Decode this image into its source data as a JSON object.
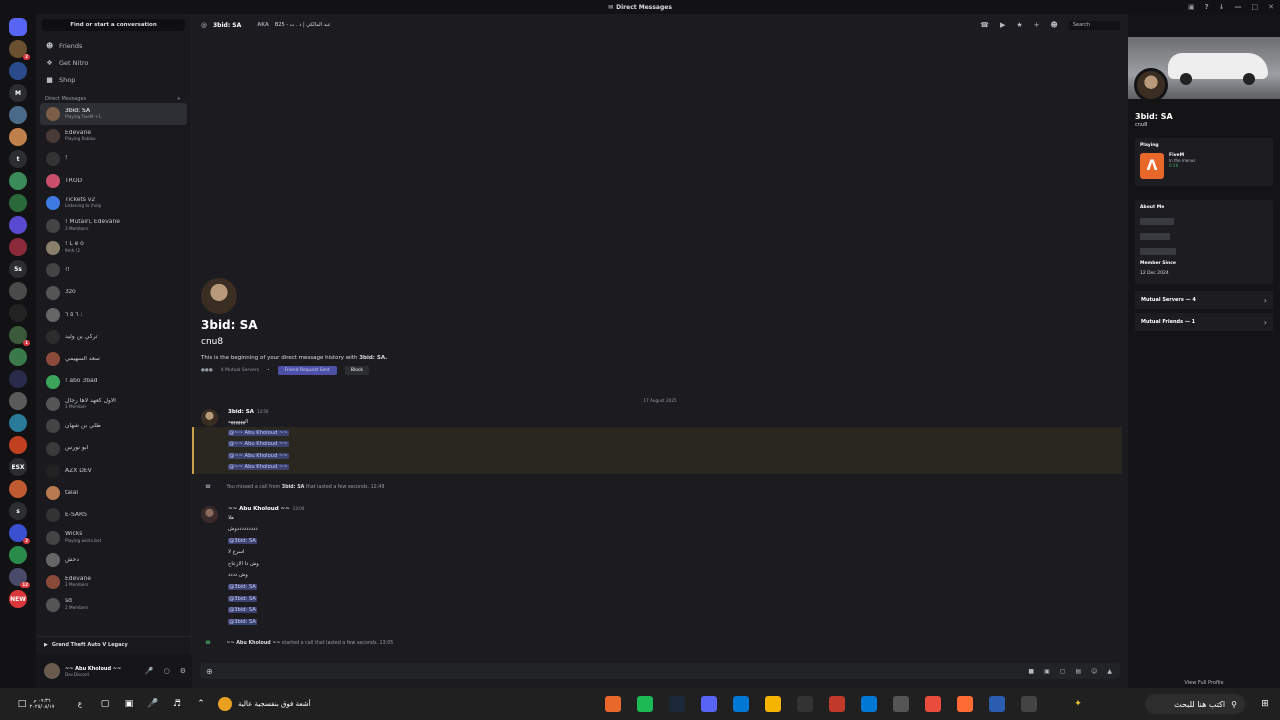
{
  "window": {
    "title": "Direct Messages"
  },
  "dm_list": {
    "find_label": "Find or start a conversation",
    "nav": [
      {
        "icon": "friends-icon",
        "label": "Friends"
      },
      {
        "icon": "nitro-icon",
        "label": "Get Nitro"
      },
      {
        "icon": "shop-icon",
        "label": "Shop"
      }
    ],
    "header": "Direct Messages",
    "items": [
      {
        "name": "3bid: SA",
        "sub": "Playing FiveM +1",
        "color": "#7a5e47",
        "active": true
      },
      {
        "name": "Edevane",
        "sub": "Playing Roblox",
        "color": "#4a3a35"
      },
      {
        "name": "!",
        "sub": "",
        "color": "#333"
      },
      {
        "name": "TROD",
        "sub": "",
        "color": "#c94f6d"
      },
      {
        "name": "Tickets v2",
        "sub": "Listening to /help",
        "color": "#3d7be0"
      },
      {
        "name": "! Mutairi, Edevane",
        "sub": "3 Members",
        "color": "#444"
      },
      {
        "name": "! L e o",
        "sub": "9mh.!2",
        "color": "#8a7f6a"
      },
      {
        "name": "!!",
        "sub": "",
        "color": "#444"
      },
      {
        "name": "3zo",
        "sub": "",
        "color": "#555"
      },
      {
        "name": "٦ ٥ ٦ :",
        "sub": "",
        "color": "#666"
      },
      {
        "name": "تركي بن وليد",
        "sub": "",
        "color": "#2c2c2c"
      },
      {
        "name": "سعد السهيمي",
        "sub": "",
        "color": "#8b4a3a"
      },
      {
        "name": "! abo 3bad",
        "sub": "",
        "color": "#3ba55c"
      },
      {
        "name": "الأول كعهد لاها رجال",
        "sub": "1 Member",
        "color": "#555"
      },
      {
        "name": "طلي بن شهان",
        "sub": "",
        "color": "#444"
      },
      {
        "name": "ابو نورس",
        "sub": "",
        "color": "#3a3a3a"
      },
      {
        "name": "AZX DEV",
        "sub": "",
        "color": "#222"
      },
      {
        "name": "talal",
        "sub": "",
        "color": "#b87a50"
      },
      {
        "name": "E-SARS",
        "sub": "",
        "color": "#333"
      },
      {
        "name": "Wicks",
        "sub": "Playing wicks.bot",
        "color": "#444"
      },
      {
        "name": "دحش",
        "sub": "",
        "color": "#666"
      },
      {
        "name": "Edevane",
        "sub": "2 Members",
        "color": "#8a4a3a"
      },
      {
        "name": "sd",
        "sub": "2 Members",
        "color": "#555"
      }
    ],
    "activity": "Grand Theft Auto V Legacy",
    "user": {
      "name": "~~ Abu Kholoud ~~",
      "status": "Dev.Discord"
    }
  },
  "servers": [
    {
      "label": "",
      "color": "#5865f2",
      "badge": ""
    },
    {
      "label": "",
      "color": "#6b5030",
      "badge": "2"
    },
    {
      "label": "",
      "color": "#2a4a8a",
      "badge": ""
    },
    {
      "label": "M",
      "color": "#2b2d31",
      "badge": ""
    },
    {
      "label": "",
      "color": "#4a6a8a",
      "badge": ""
    },
    {
      "label": "",
      "color": "#c0804a",
      "badge": ""
    },
    {
      "label": "t",
      "color": "#2b2d31",
      "badge": ""
    },
    {
      "label": "",
      "color": "#3a8a5a",
      "badge": ""
    },
    {
      "label": "",
      "color": "#2a6a3a",
      "badge": ""
    },
    {
      "label": "",
      "color": "#5a4ad0",
      "badge": ""
    },
    {
      "label": "",
      "color": "#8a2a3a",
      "badge": ""
    },
    {
      "label": "5s",
      "color": "#2b2d31",
      "badge": ""
    },
    {
      "label": "",
      "color": "#4a4a4a",
      "badge": ""
    },
    {
      "label": "",
      "color": "#222",
      "badge": ""
    },
    {
      "label": "",
      "color": "#3a5a3a",
      "badge": "1"
    },
    {
      "label": "",
      "color": "#3a7a4a",
      "badge": ""
    },
    {
      "label": "",
      "color": "#2a2a4a",
      "badge": ""
    },
    {
      "label": "",
      "color": "#5a5a5a",
      "badge": ""
    },
    {
      "label": "",
      "color": "#2a7a9a",
      "badge": ""
    },
    {
      "label": "",
      "color": "#c04020",
      "badge": ""
    },
    {
      "label": "ESX",
      "color": "#2b2d31",
      "badge": ""
    },
    {
      "label": "",
      "color": "#c05a30",
      "badge": ""
    },
    {
      "label": "s",
      "color": "#2b2d31",
      "badge": ""
    },
    {
      "label": "",
      "color": "#3a50d0",
      "badge": "2"
    },
    {
      "label": "",
      "color": "#2a8a4a",
      "badge": ""
    },
    {
      "label": "",
      "color": "#4a4a6a",
      "badge": "12"
    },
    {
      "label": "NEW",
      "color": "#da373c",
      "badge": ""
    }
  ],
  "chat": {
    "recipient": "3bid: SA",
    "aka_label": "AKA",
    "aka_value": "B25 - عبد المالكي | د . ت",
    "intro": {
      "name": "3bid: SA",
      "handle": "cnu8",
      "desc_prefix": "This is the beginning of your direct message history with",
      "desc_name": "3bid: SA.",
      "mutual_servers": "4 Mutual Servers",
      "friend_btn": "Friend Request Sent",
      "block_btn": "Block"
    },
    "date_divider": "17 August 2025",
    "msg1": {
      "author": "3bid: SA",
      "time": "12:50",
      "line1": "الههههههه",
      "mentions": [
        "@~~ Abu Kholoud ~~",
        "@~~ Abu Kholoud ~~",
        "@~~ Abu Kholoud ~~",
        "@~~ Abu Kholoud ~~"
      ]
    },
    "missed_call": {
      "prefix": "You missed a call from",
      "name": "3bid: SA",
      "suffix": "that lasted a few seconds.",
      "time": "12:49"
    },
    "msg2": {
      "author": "~~ Abu Kholoud ~~",
      "time": "13:04",
      "lines": [
        "هلا",
        "دددددددددوش",
        "@3bid: SA",
        "اسرع لا",
        "وش ذا الازعاج",
        "وش دددد",
        "@3bid: SA",
        "@3bid: SA",
        "@3bid: SA",
        "@3bid: SA"
      ]
    },
    "started_call": {
      "name": "~~ Abu Kholoud ~~",
      "suffix": "started a call that lasted a few seconds.",
      "time": "13:05"
    },
    "search_placeholder": "Search"
  },
  "profile": {
    "name": "3bid: SA",
    "handle": "cnu8",
    "playing_label": "Playing",
    "game": "FiveM",
    "game_detail": "In the menus",
    "game_time": "0:58",
    "about_label": "About Me",
    "member_since_label": "Member Since",
    "member_since": "12 Dec 2024",
    "mutual_servers": "Mutual Servers — 4",
    "mutual_friends": "Mutual Friends — 1",
    "view_full": "View Full Profile"
  },
  "taskbar": {
    "time": "٠٩:٣٦ م",
    "date": "٢٠٢٥/٠٨/١٧",
    "lang": "ع",
    "notif": "أشعة فوق بنفسجية عالية",
    "search_text": "اكتب هنا للبحث",
    "apps": [
      "#e8682b",
      "#1db954",
      "#1b2838",
      "#5865f2",
      "#0078d4",
      "#f4b400",
      "#333",
      "#c0392b",
      "#0078d4",
      "#555",
      "#e74c3c",
      "#ff6b35",
      "#2a5db0",
      "#444"
    ]
  }
}
